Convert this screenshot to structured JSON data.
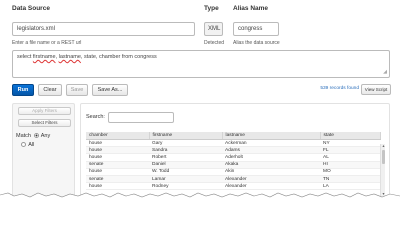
{
  "labels": {
    "data_source": "Data Source",
    "type": "Type",
    "alias_name": "Alias Name"
  },
  "fields": {
    "data_source_value": "legislators.xml",
    "type_value": "XML",
    "alias_value": "congress"
  },
  "hints": {
    "data_source_hint": "Enter a file name or a REST url",
    "type_hint": "Detected",
    "alias_hint": "Alias the data source"
  },
  "query": {
    "prefix": "select ",
    "word1": "firstname",
    "sep": ", ",
    "word2": "lastname",
    "suffix": ", state, chamber from congress"
  },
  "toolbar": {
    "run_label": "Run",
    "clear_label": "Clear",
    "save_label": "Save",
    "save_as_label": "Save As...",
    "records_text": "539 records found",
    "view_script_label": "View Script"
  },
  "filters": {
    "apply_label": "Apply Filters",
    "select_label": "Select Filters",
    "match_label": "Match",
    "any_label": "Any",
    "all_label": "All"
  },
  "results": {
    "search_label": "Search:",
    "columns": [
      "chamber",
      "firstname",
      "lastname",
      "state"
    ],
    "rows": [
      [
        "house",
        "Gary",
        "Ackerman",
        "NY"
      ],
      [
        "house",
        "Sandra",
        "Adams",
        "FL"
      ],
      [
        "house",
        "Robert",
        "Aderholt",
        "AL"
      ],
      [
        "senate",
        "Daniel",
        "Akaka",
        "HI"
      ],
      [
        "house",
        "W. Todd",
        "Akin",
        "MO"
      ],
      [
        "senate",
        "Lamar",
        "Alexander",
        "TN"
      ],
      [
        "house",
        "Rodney",
        "Alexander",
        "LA"
      ]
    ]
  },
  "colors": {
    "run_button": "#0456a8",
    "records_link": "#2a6ebb",
    "spellcheck_underline": "#d33"
  }
}
